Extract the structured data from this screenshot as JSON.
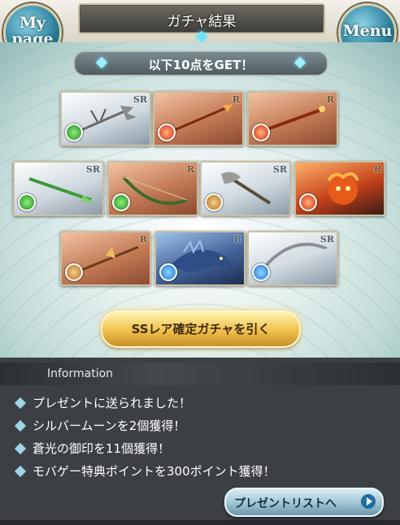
{
  "header": {
    "title": "ガチャ結果",
    "mypage_line1": "My",
    "mypage_line2": "page",
    "menu_label": "Menu"
  },
  "banner": {
    "text": "以下10点をGET！"
  },
  "cards": [
    {
      "rarity": "SR",
      "element": "wind",
      "type": "weapon"
    },
    {
      "rarity": "R",
      "element": "fire",
      "type": "weapon"
    },
    {
      "rarity": "R",
      "element": "fire",
      "type": "weapon"
    },
    {
      "rarity": "SR",
      "element": "wind",
      "type": "weapon"
    },
    {
      "rarity": "R",
      "element": "wind",
      "type": "weapon"
    },
    {
      "rarity": "SR",
      "element": "earth",
      "type": "weapon"
    },
    {
      "rarity": "R",
      "element": "fire",
      "type": "summon"
    },
    {
      "rarity": "R",
      "element": "earth",
      "type": "weapon"
    },
    {
      "rarity": "R",
      "element": "water",
      "type": "summon"
    },
    {
      "rarity": "SR",
      "element": "water",
      "type": "weapon"
    }
  ],
  "ssr_button": {
    "label": "SSレア確定ガチャを引く"
  },
  "information": {
    "title": "Information",
    "items": [
      "プレゼントに送られました！",
      "シルバームーンを2個獲得！",
      "蒼光の御印を11個獲得！",
      "モバゲー特典ポイントを300ポイント獲得！"
    ],
    "present_button": "プレゼントリストへ"
  },
  "colors": {
    "wind": "#228a20",
    "fire": "#d0321a",
    "earth": "#b06d1e",
    "water": "#1f6fd2"
  }
}
